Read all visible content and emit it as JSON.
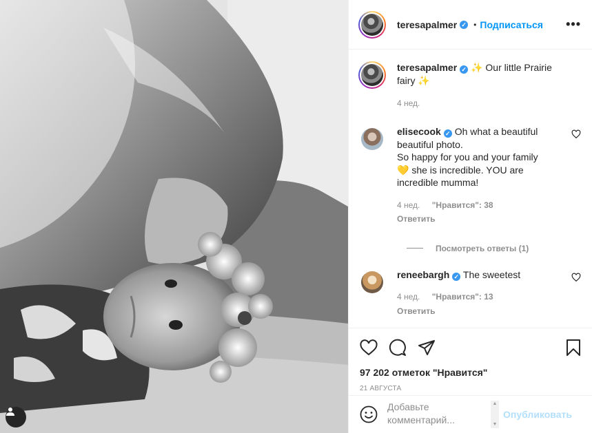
{
  "post": {
    "username": "teresapalmer",
    "follow_label": "Подписаться",
    "separator": "•",
    "more_label": "•••",
    "photo_alt": "",
    "caption": {
      "username": "teresapalmer",
      "text": "Our little Prairie fairy",
      "sparkle": "✨",
      "time": "4 нед."
    },
    "comments": [
      {
        "username": "elisecook",
        "text_1": "Oh what a beautiful beautiful photo.",
        "text_2": "So happy for you and your family",
        "heart": "💛",
        "text_3": "she is incredible. YOU are incredible mumma!",
        "time": "4 нед.",
        "likes": "\"Нравится\": 38",
        "reply": "Ответить",
        "view_replies": "Посмотреть ответы (1)"
      },
      {
        "username": "reneebargh",
        "text": "The sweetest",
        "time": "4 нед.",
        "likes": "\"Нравится\": 13",
        "reply": "Ответить"
      }
    ],
    "likes_count": "97 202 отметок \"Нравится\"",
    "date": "21 АВГУСТА",
    "comment_placeholder": "Добавьте комментарий...",
    "publish_label": "Опубликовать"
  },
  "colors": {
    "accent": "#0095f6",
    "verified": "#3897f0",
    "publish_disabled": "#b2dffc",
    "muted_text": "#8e8e8e"
  }
}
